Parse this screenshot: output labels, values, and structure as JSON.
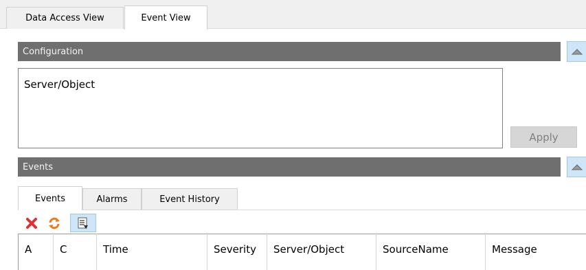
{
  "tabs": [
    {
      "label": "Data Access View"
    },
    {
      "label": "Event View"
    }
  ],
  "active_tab": "Event View",
  "configuration": {
    "title": "Configuration",
    "field_text": "Server/Object",
    "apply_label": "Apply"
  },
  "events_section": {
    "title": "Events"
  },
  "inner_tabs": [
    {
      "label": "Events"
    },
    {
      "label": "Alarms"
    },
    {
      "label": "Event History"
    }
  ],
  "toolbar": [
    {
      "icon": "delete-icon"
    },
    {
      "icon": "refresh-icon"
    },
    {
      "icon": "column-view-icon"
    }
  ],
  "table": {
    "columns": [
      "A",
      "C",
      "Time",
      "Severity",
      "Server/Object",
      "SourceName",
      "Message"
    ]
  },
  "colors": {
    "section_header": "#6f6f6f",
    "collapse_button": "#cfe6f8",
    "delete_icon": "#e03030",
    "refresh_icon": "#f07a18"
  }
}
